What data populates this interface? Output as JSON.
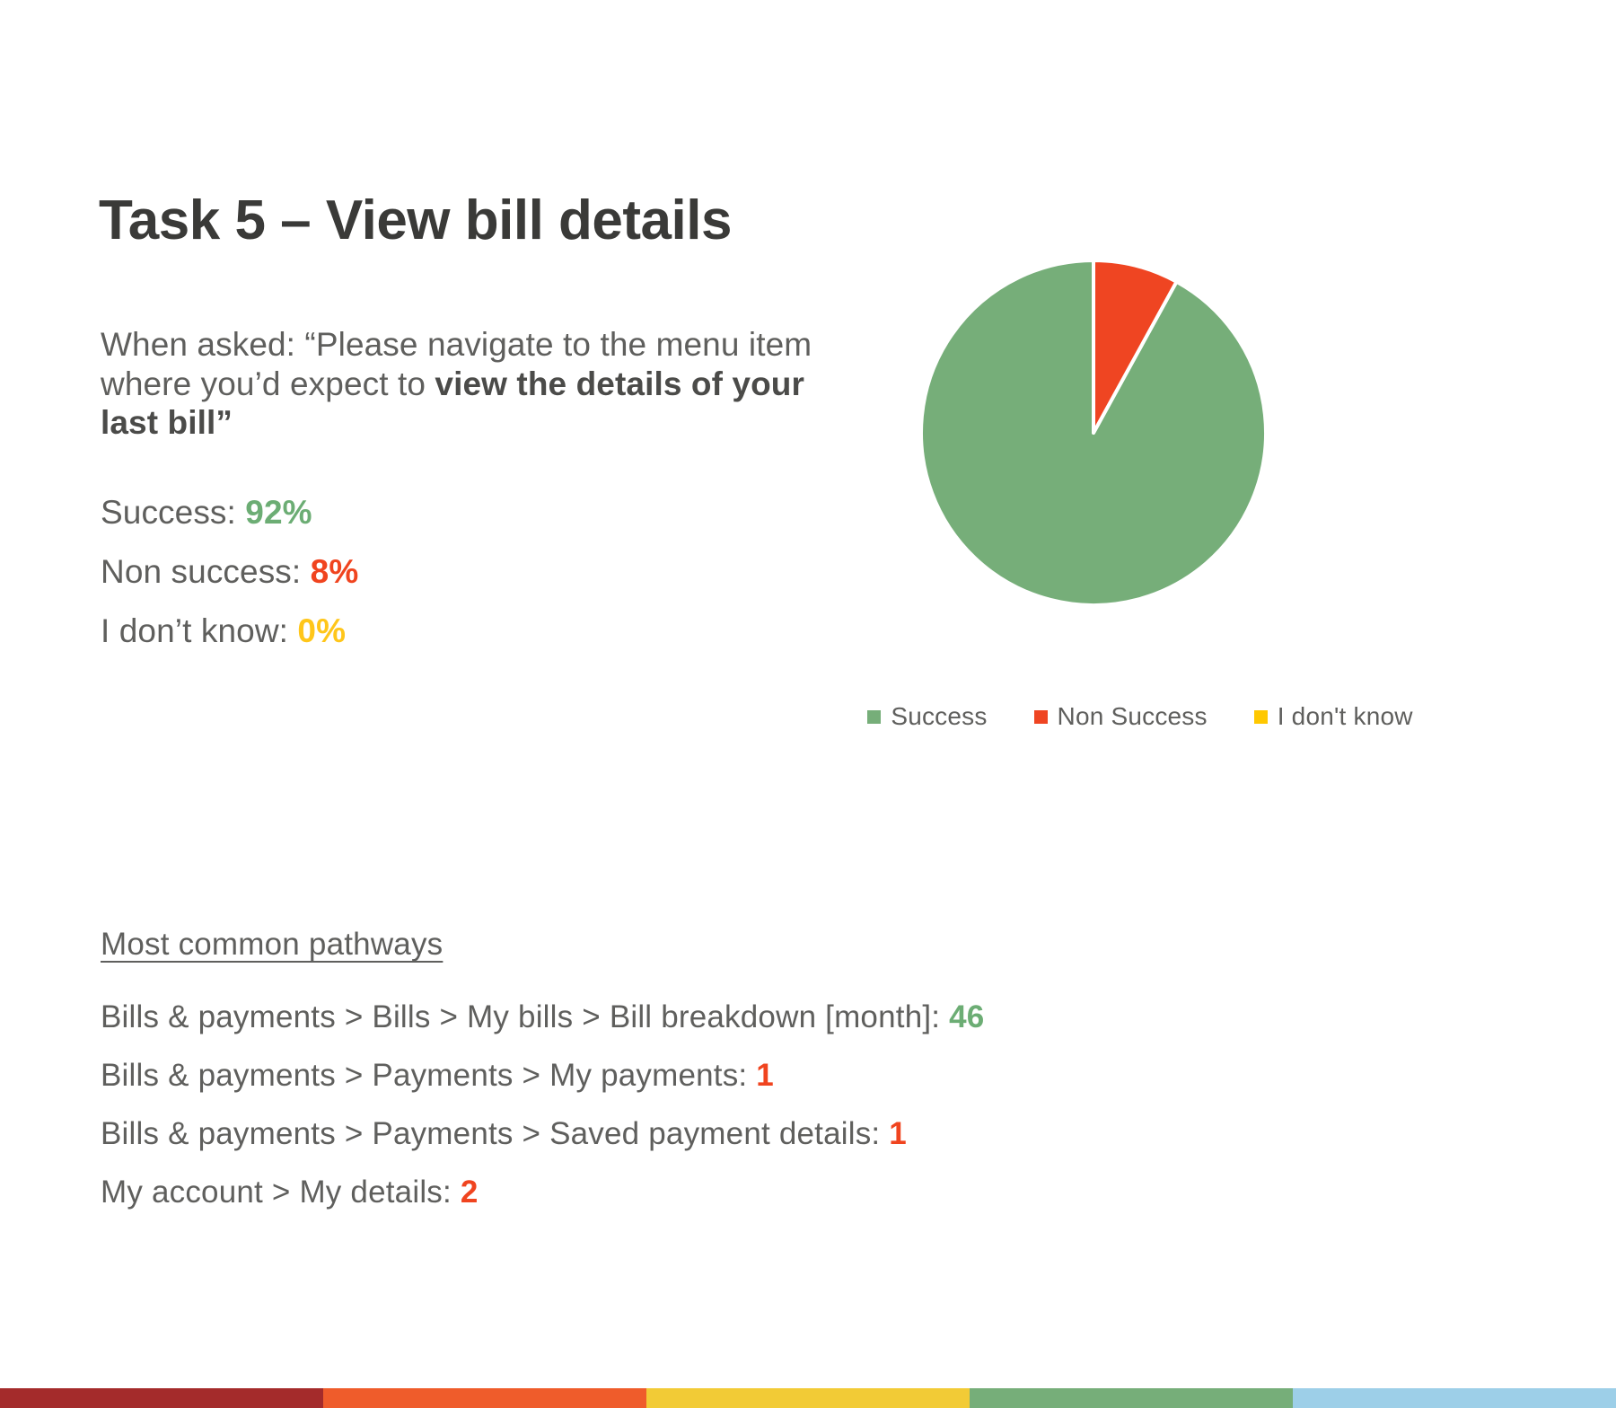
{
  "slide": {
    "title": "Task 5 – View bill details",
    "background": "#FFFFFF"
  },
  "question": {
    "lead": "When asked: “Please navigate to the menu item where you’d expect to ",
    "emphasis": "view the details of your last bill”"
  },
  "stats": {
    "items": [
      {
        "label": "Success: ",
        "value": "92%",
        "color": "#6CAD74"
      },
      {
        "label": "Non success: ",
        "value": "8%",
        "color": "#F0441F"
      },
      {
        "label": "I don’t know: ",
        "value": "0%",
        "color": "#FFC61A"
      }
    ]
  },
  "chart_data": {
    "type": "pie",
    "title": "",
    "labels": [
      "Success",
      "Non Success",
      "I don't know"
    ],
    "values": [
      92,
      8,
      0
    ],
    "unit": "%",
    "colors": [
      "#76AE79",
      "#EF4522",
      "#FFC800"
    ],
    "start_angle_deg": 0,
    "direction": "counterclockwise",
    "slice_gap": "white separator",
    "legend": {
      "position": "bottom",
      "entries": [
        {
          "label": "Success",
          "color": "#76AE79"
        },
        {
          "label": "Non Success",
          "color": "#EF4522"
        },
        {
          "label": "I don't know",
          "color": "#FFC800"
        }
      ]
    }
  },
  "pathways": {
    "heading": "Most common pathways",
    "rows": [
      {
        "path": "Bills & payments > Bills > My bills > Bill breakdown [month]: ",
        "count": "46",
        "color": "#6CAD74"
      },
      {
        "path": "Bills & payments > Payments > My payments: ",
        "count": "1",
        "color": "#F0441F"
      },
      {
        "path": "Bills & payments > Payments > Saved payment details: ",
        "count": "1",
        "color": "#F0441F"
      },
      {
        "path": "My account > My details: ",
        "count": "2",
        "color": "#F0441F"
      }
    ]
  },
  "bottom_bar": {
    "segments": [
      "#A42B2B",
      "#EF5C2B",
      "#F2CB36",
      "#76AE79",
      "#9DCFE8"
    ]
  }
}
